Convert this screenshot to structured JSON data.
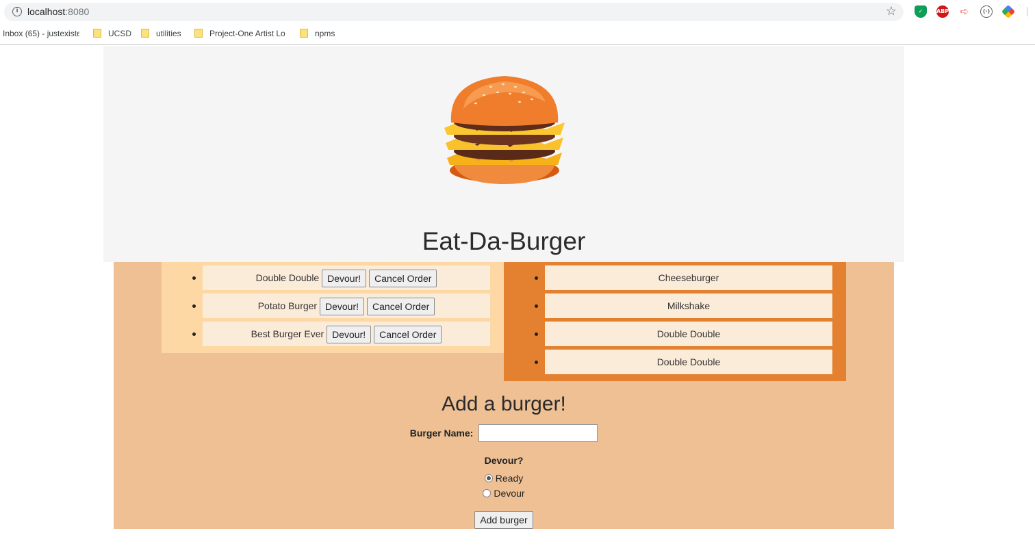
{
  "browser": {
    "url_host": "localhost",
    "url_port": ":8080",
    "bookmarks": [
      {
        "label": "Inbox (65) - justexiste"
      },
      {
        "label": "UCSD"
      },
      {
        "label": "utilities"
      },
      {
        "label": "Project-One Artist Lo"
      },
      {
        "label": "npms"
      }
    ],
    "extensions": {
      "abp": "ABP",
      "circle": "(·)",
      "arrow": "➪"
    }
  },
  "header": {
    "title": "Eat-Da-Burger"
  },
  "not_devoured": [
    {
      "name": "Double Double",
      "devour_label": "Devour!",
      "cancel_label": "Cancel Order"
    },
    {
      "name": "Potato Burger",
      "devour_label": "Devour!",
      "cancel_label": "Cancel Order"
    },
    {
      "name": "Best Burger Ever",
      "devour_label": "Devour!",
      "cancel_label": "Cancel Order"
    }
  ],
  "devoured": [
    {
      "name": "Cheeseburger"
    },
    {
      "name": "Milkshake"
    },
    {
      "name": "Double Double"
    },
    {
      "name": "Double Double"
    }
  ],
  "form": {
    "title": "Add a burger!",
    "name_label": "Burger Name:",
    "name_value": "",
    "devour_label": "Devour?",
    "options": [
      {
        "label": "Ready",
        "checked": true
      },
      {
        "label": "Devour",
        "checked": false
      }
    ],
    "submit_label": "Add burger"
  },
  "colors": {
    "jumbotron_bg": "#f5f5f5",
    "main_bg": "#eec094",
    "left_col_bg": "#fdd8a4",
    "right_col_bg": "#e38130",
    "item_bg": "#fbebd9"
  }
}
